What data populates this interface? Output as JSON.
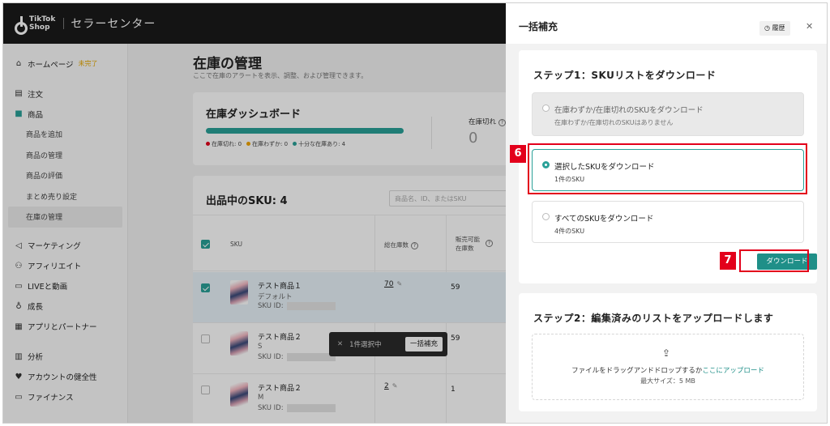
{
  "app": {
    "logo_line1": "TikTok",
    "logo_line2": "Shop",
    "title": "セラーセンター"
  },
  "sidebar": {
    "home": "ホームページ",
    "home_badge": "未完了",
    "orders": "注文",
    "products": "商品",
    "sub_items": [
      "商品を追加",
      "商品の管理",
      "商品の評価",
      "まとめ売り設定",
      "在庫の管理"
    ],
    "items": [
      "マーケティング",
      "アフィリエイト",
      "LIVEと動画",
      "成長",
      "アプリとパートナー"
    ],
    "items2": [
      "分析",
      "アカウントの健全性",
      "ファイナンス"
    ]
  },
  "page": {
    "title": "在庫の管理",
    "subtitle": "ここで在庫のアラートを表示、調整、および管理できます。"
  },
  "dashboard": {
    "title": "在庫ダッシュボード",
    "legend": [
      "在庫切れ: 0",
      "在庫わずか: 0",
      "十分な在庫あり: 4"
    ],
    "out_label": "在庫切れ",
    "out_value": "0"
  },
  "sku_list": {
    "title": "出品中のSKU: 4",
    "search_placeholder": "商品名、ID、またはSKU",
    "col_sku": "SKU",
    "col_stock": "総在庫数",
    "col_avail": "販売可能在庫数",
    "rows": [
      {
        "name": "テスト商品１",
        "variant": "デフォルト",
        "id_label": "SKU ID:",
        "stock": "70",
        "avail": "59"
      },
      {
        "name": "テスト商品２",
        "variant": "S",
        "id_label": "SKU ID:",
        "stock": "",
        "avail": "59"
      },
      {
        "name": "テスト商品２",
        "variant": "M",
        "id_label": "SKU ID:",
        "stock": "2",
        "avail": "1"
      }
    ]
  },
  "toast": {
    "text": "1件選択中",
    "button": "一括補充"
  },
  "drawer": {
    "title": "一括補充",
    "history": "履歴",
    "step1_title": "ステップ1：SKUリストをダウンロード",
    "options": [
      {
        "label": "在庫わずか/在庫切れのSKUをダウンロード",
        "sub": "在庫わずか/在庫切れのSKUはありません"
      },
      {
        "label": "選択したSKUをダウンロード",
        "sub": "1件のSKU"
      },
      {
        "label": "すべてのSKUをダウンロード",
        "sub": "4件のSKU"
      }
    ],
    "download": "ダウンロード",
    "step2_title": "ステップ2：編集済みのリストをアップロードします",
    "upload_text": "ファイルをドラッグアンドドロップするか",
    "upload_link": "ここにアップロード",
    "upload_size": "最大サイズ：5 MB"
  },
  "markers": {
    "m6": "6",
    "m7": "7"
  },
  "colors": {
    "accent": "#2aa198",
    "button": "#1f8f88",
    "highlight": "#e3001b"
  }
}
